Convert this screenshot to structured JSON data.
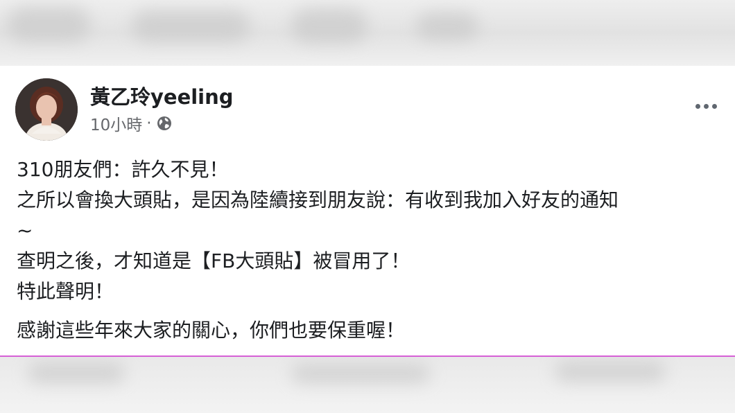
{
  "post": {
    "author": {
      "name": "黃乙玲yeeling"
    },
    "meta": {
      "time": "10小時",
      "separator": "·",
      "privacy_icon": "globe-icon"
    },
    "more_icon": "more-horizontal-icon",
    "body": {
      "line1": "310朋友們：許久不見！",
      "line2": "之所以會換大頭貼，是因為陸續接到朋友說：有收到我加入好友的通知",
      "line3": "~",
      "line4": "查明之後，才知道是【FB大頭貼】被冒用了！",
      "line5": "特此聲明！",
      "line6": "感謝這些年來大家的關心，你們也要保重喔！"
    }
  },
  "colors": {
    "card_background": "#ffffff",
    "text_primary": "#1c1e21",
    "text_secondary": "#65676b",
    "divider_accent": "#d65fd6"
  }
}
